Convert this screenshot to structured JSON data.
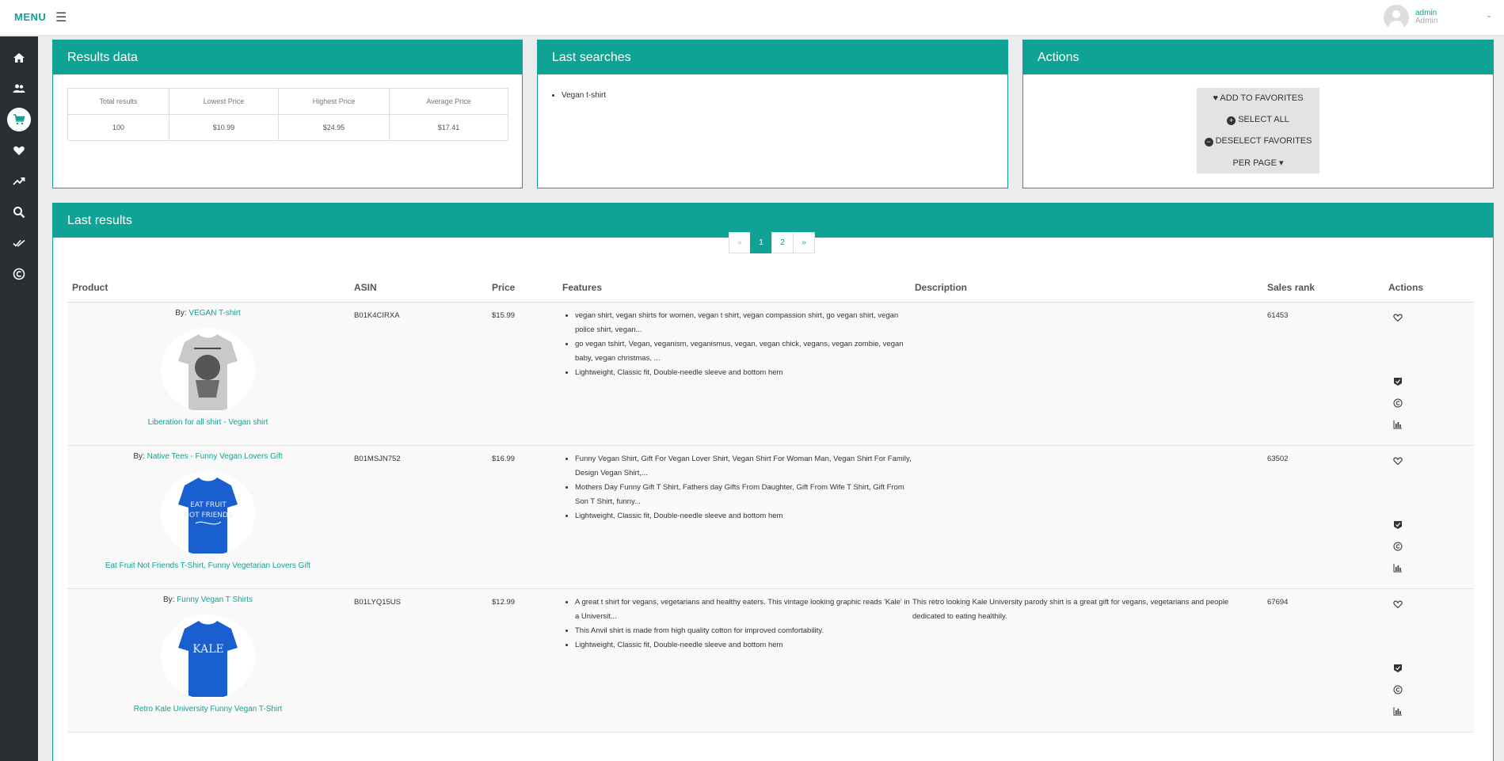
{
  "topbar": {
    "menu_label": "MENU",
    "user_name": "admin",
    "user_role": "Admin"
  },
  "sidebar": {
    "items": [
      "home-icon",
      "users-icon",
      "cart-icon",
      "heart-icon",
      "trending-icon",
      "search-icon",
      "double-check-icon",
      "copyright-icon"
    ],
    "active": "cart-icon"
  },
  "results_data": {
    "title": "Results data",
    "headers": [
      "Total results",
      "Lowest Price",
      "Highest Price",
      "Average Price"
    ],
    "values": [
      "100",
      "$10.99",
      "$24.95",
      "$17.41"
    ]
  },
  "last_searches": {
    "title": "Last searches",
    "items": [
      "Vegan t-shirt"
    ]
  },
  "actions": {
    "title": "Actions",
    "add_favorites": "ADD TO FAVORITES",
    "select_all": "SELECT ALL",
    "deselect_favorites": "DESELECT FAVORITES",
    "per_page": "PER PAGE"
  },
  "last_results": {
    "title": "Last results",
    "pagination": {
      "prev": "«",
      "pages": [
        "1",
        "2"
      ],
      "next": "»",
      "current": "1"
    },
    "columns": [
      "Product",
      "ASIN",
      "Price",
      "Features",
      "Description",
      "Sales rank",
      "Actions"
    ],
    "by_prefix": "By:",
    "rows": [
      {
        "brand": "VEGAN T-shirt",
        "title": "Liberation for all shirt - Vegan shirt",
        "asin": "B01K4CIRXA",
        "price": "$15.99",
        "features": [
          "vegan shirt, vegan shirts for women, vegan t shirt, vegan compassion shirt, go vegan shirt, vegan police shirt, vegan...",
          "go vegan tshirt, Vegan, veganism, veganismus, vegan, vegan chick, vegans, vegan zombie, vegan baby, vegan christmas, ...",
          "Lightweight, Classic fit, Double-needle sleeve and bottom hem"
        ],
        "description": "",
        "sales_rank": "61453",
        "shirt_color": "#c9c9c9",
        "shirt_print": ""
      },
      {
        "brand": "Native Tees - Funny Vegan Lovers Gift",
        "title": "Eat Fruit Not Friends T-Shirt, Funny Vegetarian Lovers Gift",
        "asin": "B01MSJN752",
        "price": "$16.99",
        "features": [
          "Funny Vegan Shirt, Gift For Vegan Lover Shirt, Vegan Shirt For Woman Man, Vegan Shirt For Family, Design Vegan Shirt,...",
          "Mothers Day Funny Gift T Shirt, Fathers day Gifts From Daughter, Gift From Wife T Shirt, Gift From Son T Shirt, funny...",
          "Lightweight, Classic fit, Double-needle sleeve and bottom hem"
        ],
        "description": "",
        "sales_rank": "63502",
        "shirt_color": "#1a5fd0",
        "shirt_print": "EAT FRUIT NOT FRIENDS"
      },
      {
        "brand": "Funny Vegan T Shirts",
        "title": "Retro Kale University Funny Vegan T-Shirt",
        "asin": "B01LYQ15US",
        "price": "$12.99",
        "features": [
          "A great t shirt for vegans, vegetarians and healthy eaters. This vintage looking graphic reads 'Kale' in a Universit...",
          "This Anvil shirt is made from high quality cotton for improved comfortability.",
          "Lightweight, Classic fit, Double-needle sleeve and bottom hem"
        ],
        "description": "This retro looking Kale University parody shirt is a great gift for vegans, vegetarians and people dedicated to eating healthily.",
        "sales_rank": "67694",
        "shirt_color": "#1a5fd0",
        "shirt_print": "KALE"
      }
    ]
  }
}
